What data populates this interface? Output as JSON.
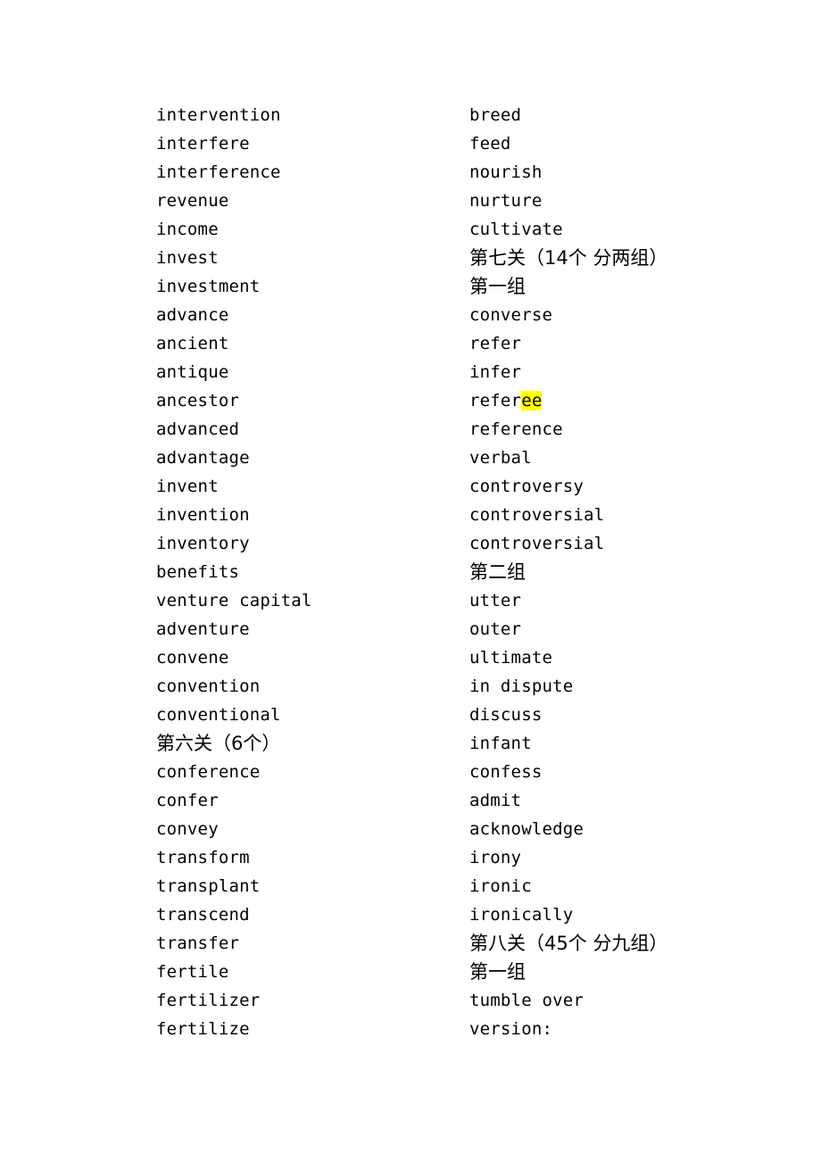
{
  "document": {
    "page_background": "#ffffff",
    "text_color": "#000000",
    "highlight_color": "#ffff00",
    "columns": [
      {
        "name": "left-column",
        "lines": [
          {
            "text": "intervention",
            "script": "en"
          },
          {
            "text": "interfere",
            "script": "en"
          },
          {
            "text": "interference",
            "script": "en"
          },
          {
            "text": "revenue",
            "script": "en"
          },
          {
            "text": "income",
            "script": "en"
          },
          {
            "text": "invest",
            "script": "en"
          },
          {
            "text": "investment",
            "script": "en"
          },
          {
            "text": "advance",
            "script": "en"
          },
          {
            "text": "ancient",
            "script": "en"
          },
          {
            "text": "antique",
            "script": "en"
          },
          {
            "text": "ancestor",
            "script": "en"
          },
          {
            "text": "advanced",
            "script": "en"
          },
          {
            "text": "advantage",
            "script": "en"
          },
          {
            "text": "invent",
            "script": "en"
          },
          {
            "text": "invention",
            "script": "en"
          },
          {
            "text": "inventory",
            "script": "en"
          },
          {
            "text": "benefits",
            "script": "en"
          },
          {
            "text": "venture capital",
            "script": "en"
          },
          {
            "text": "adventure",
            "script": "en"
          },
          {
            "text": "convene",
            "script": "en"
          },
          {
            "text": "convention",
            "script": "en"
          },
          {
            "text": "conventional",
            "script": "en"
          },
          {
            "text": "第六关（6个）",
            "script": "cn"
          },
          {
            "text": "conference",
            "script": "en"
          },
          {
            "text": "confer",
            "script": "en"
          },
          {
            "text": "convey",
            "script": "en"
          },
          {
            "text": "transform",
            "script": "en"
          },
          {
            "text": "transplant",
            "script": "en"
          },
          {
            "text": "transcend",
            "script": "en"
          },
          {
            "text": "transfer",
            "script": "en"
          },
          {
            "text": "fertile",
            "script": "en"
          },
          {
            "text": "fertilizer",
            "script": "en"
          },
          {
            "text": "fertilize",
            "script": "en"
          }
        ]
      },
      {
        "name": "right-column",
        "lines": [
          {
            "text": "breed",
            "script": "en"
          },
          {
            "text": "feed",
            "script": "en"
          },
          {
            "text": "nourish",
            "script": "en"
          },
          {
            "text": "nurture",
            "script": "en"
          },
          {
            "text": "cultivate",
            "script": "en"
          },
          {
            "text": "第七关（14个 分两组）",
            "script": "cn"
          },
          {
            "text": "第一组",
            "script": "cn"
          },
          {
            "text": "converse",
            "script": "en"
          },
          {
            "text": "refer",
            "script": "en"
          },
          {
            "text": "infer",
            "script": "en"
          },
          {
            "text": "referee",
            "script": "en",
            "highlight": {
              "start": 5,
              "end": 7
            }
          },
          {
            "text": "reference",
            "script": "en"
          },
          {
            "text": "verbal",
            "script": "en"
          },
          {
            "text": "controversy",
            "script": "en"
          },
          {
            "text": "controversial",
            "script": "en"
          },
          {
            "text": "controversial",
            "script": "en"
          },
          {
            "text": "第二组",
            "script": "cn"
          },
          {
            "text": "utter",
            "script": "en"
          },
          {
            "text": "outer",
            "script": "en"
          },
          {
            "text": "ultimate",
            "script": "en"
          },
          {
            "text": "in dispute",
            "script": "en"
          },
          {
            "text": "discuss",
            "script": "en"
          },
          {
            "text": "infant",
            "script": "en"
          },
          {
            "text": "confess",
            "script": "en"
          },
          {
            "text": "admit",
            "script": "en"
          },
          {
            "text": "acknowledge",
            "script": "en"
          },
          {
            "text": "irony",
            "script": "en"
          },
          {
            "text": "ironic",
            "script": "en"
          },
          {
            "text": "ironically",
            "script": "en"
          },
          {
            "text": "第八关（45个 分九组）",
            "script": "cn"
          },
          {
            "text": "第一组",
            "script": "cn"
          },
          {
            "text": "tumble over",
            "script": "en"
          },
          {
            "text": "version:",
            "script": "en"
          }
        ]
      }
    ]
  }
}
